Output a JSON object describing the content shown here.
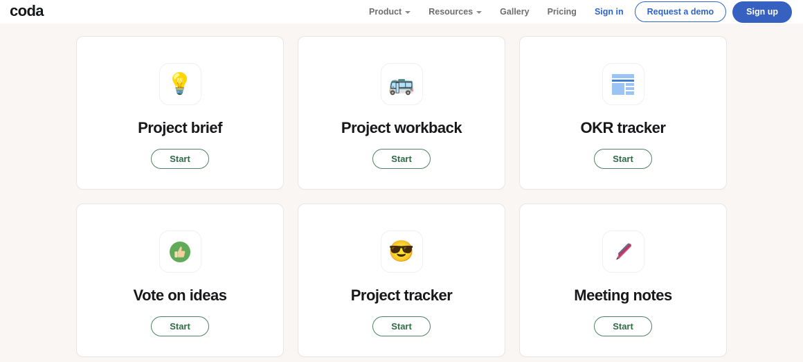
{
  "header": {
    "logo": "coda",
    "nav": [
      {
        "label": "Product",
        "icon": "chevron-down-icon",
        "has_caret": true
      },
      {
        "label": "Resources",
        "icon": "chevron-down-icon",
        "has_caret": true
      },
      {
        "label": "Gallery",
        "has_caret": false
      },
      {
        "label": "Pricing",
        "has_caret": false
      }
    ],
    "signin_label": "Sign in",
    "demo_label": "Request a demo",
    "signup_label": "Sign up"
  },
  "colors": {
    "page_background": "#faf6f3",
    "header_background": "#ffffff",
    "card_background": "#ffffff",
    "card_border": "#e7e4e1",
    "brand_blue": "#2f63c9",
    "signup_blue": "#3761c0",
    "start_green_text": "#2f6b45",
    "start_green_border": "#4f8262",
    "title_black": "#18181a",
    "nav_gray": "#6e6e70"
  },
  "cards": [
    {
      "title": "Project brief",
      "icon": "lightbulb-icon",
      "emoji": "💡",
      "button": "Start"
    },
    {
      "title": "Project workback",
      "icon": "bus-icon",
      "emoji": "🚌",
      "button": "Start"
    },
    {
      "title": "OKR tracker",
      "icon": "layout-grid-icon",
      "emoji": "",
      "button": "Start"
    },
    {
      "title": "Vote on ideas",
      "icon": "thumbs-up-icon",
      "emoji": "👍",
      "button": "Start"
    },
    {
      "title": "Project tracker",
      "icon": "sunglasses-face-icon",
      "emoji": "😎",
      "button": "Start"
    },
    {
      "title": "Meeting notes",
      "icon": "pen-icon",
      "emoji": "🖊",
      "button": "Start"
    }
  ]
}
